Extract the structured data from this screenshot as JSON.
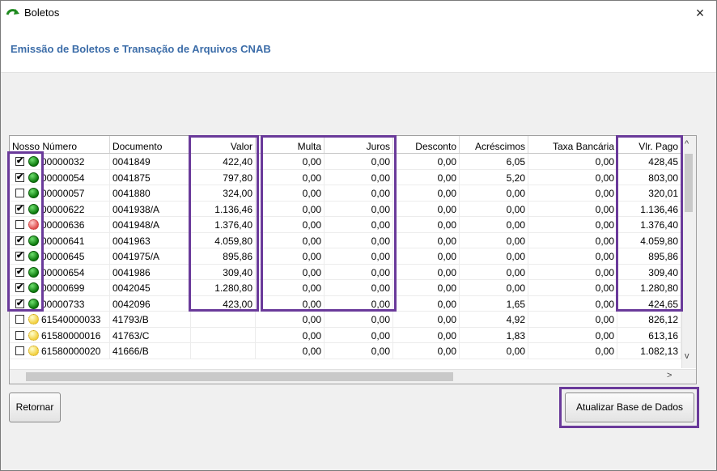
{
  "window": {
    "title": "Boletos",
    "subtitle": "Emissão de Boletos e Transação de Arquivos CNAB"
  },
  "table": {
    "columns": [
      "Nosso Número",
      "Documento",
      "Valor",
      "Multa",
      "Juros",
      "Desconto",
      "Acréscimos",
      "Taxa Bancária",
      "Vlr. Pago"
    ],
    "rows": [
      {
        "checked": true,
        "status": "green",
        "nosso": "00000032",
        "doc": "0041849",
        "valor": "422,40",
        "multa": "0,00",
        "juros": "0,00",
        "desconto": "0,00",
        "acrescimos": "6,05",
        "taxa": "0,00",
        "pago": "428,45"
      },
      {
        "checked": true,
        "status": "green",
        "nosso": "00000054",
        "doc": "0041875",
        "valor": "797,80",
        "multa": "0,00",
        "juros": "0,00",
        "desconto": "0,00",
        "acrescimos": "5,20",
        "taxa": "0,00",
        "pago": "803,00"
      },
      {
        "checked": false,
        "status": "green",
        "nosso": "00000057",
        "doc": "0041880",
        "valor": "324,00",
        "multa": "0,00",
        "juros": "0,00",
        "desconto": "0,00",
        "acrescimos": "0,00",
        "taxa": "0,00",
        "pago": "320,01"
      },
      {
        "checked": true,
        "status": "green",
        "nosso": "00000622",
        "doc": "0041938/A",
        "valor": "1.136,46",
        "multa": "0,00",
        "juros": "0,00",
        "desconto": "0,00",
        "acrescimos": "0,00",
        "taxa": "0,00",
        "pago": "1.136,46"
      },
      {
        "checked": false,
        "status": "red",
        "nosso": "00000636",
        "doc": "0041948/A",
        "valor": "1.376,40",
        "multa": "0,00",
        "juros": "0,00",
        "desconto": "0,00",
        "acrescimos": "0,00",
        "taxa": "0,00",
        "pago": "1.376,40"
      },
      {
        "checked": true,
        "status": "green",
        "nosso": "00000641",
        "doc": "0041963",
        "valor": "4.059,80",
        "multa": "0,00",
        "juros": "0,00",
        "desconto": "0,00",
        "acrescimos": "0,00",
        "taxa": "0,00",
        "pago": "4.059,80"
      },
      {
        "checked": true,
        "status": "green",
        "nosso": "00000645",
        "doc": "0041975/A",
        "valor": "895,86",
        "multa": "0,00",
        "juros": "0,00",
        "desconto": "0,00",
        "acrescimos": "0,00",
        "taxa": "0,00",
        "pago": "895,86"
      },
      {
        "checked": true,
        "status": "green",
        "nosso": "00000654",
        "doc": "0041986",
        "valor": "309,40",
        "multa": "0,00",
        "juros": "0,00",
        "desconto": "0,00",
        "acrescimos": "0,00",
        "taxa": "0,00",
        "pago": "309,40"
      },
      {
        "checked": true,
        "status": "green",
        "nosso": "00000699",
        "doc": "0042045",
        "valor": "1.280,80",
        "multa": "0,00",
        "juros": "0,00",
        "desconto": "0,00",
        "acrescimos": "0,00",
        "taxa": "0,00",
        "pago": "1.280,80"
      },
      {
        "checked": true,
        "status": "green",
        "nosso": "00000733",
        "doc": "0042096",
        "valor": "423,00",
        "multa": "0,00",
        "juros": "0,00",
        "desconto": "0,00",
        "acrescimos": "1,65",
        "taxa": "0,00",
        "pago": "424,65"
      },
      {
        "checked": false,
        "status": "yellow",
        "nosso": "61540000033",
        "doc": "41793/B",
        "valor": "",
        "multa": "0,00",
        "juros": "0,00",
        "desconto": "0,00",
        "acrescimos": "4,92",
        "taxa": "0,00",
        "pago": "826,12"
      },
      {
        "checked": false,
        "status": "yellow",
        "nosso": "61580000016",
        "doc": "41763/C",
        "valor": "",
        "multa": "0,00",
        "juros": "0,00",
        "desconto": "0,00",
        "acrescimos": "1,83",
        "taxa": "0,00",
        "pago": "613,16"
      },
      {
        "checked": false,
        "status": "yellow",
        "nosso": "61580000020",
        "doc": "41666/B",
        "valor": "",
        "multa": "0,00",
        "juros": "0,00",
        "desconto": "0,00",
        "acrescimos": "0,00",
        "taxa": "0,00",
        "pago": "1.082,13"
      }
    ]
  },
  "buttons": {
    "retornar": "Retornar",
    "atualizar": "Atualizar Base de Dados"
  },
  "icons": {
    "close": "×",
    "scroll_up": "^",
    "scroll_down": "v",
    "scroll_right": ">",
    "checkmark": "✔"
  },
  "colors": {
    "subtitle": "#3b6ca8",
    "highlight": "#6a3a9a"
  }
}
